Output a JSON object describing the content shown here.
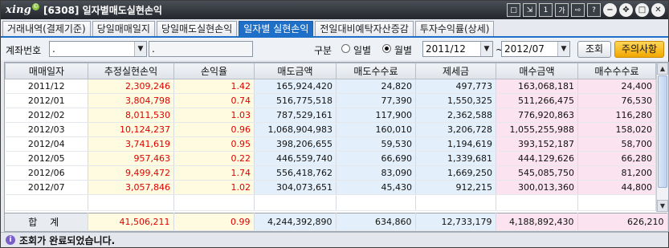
{
  "app": {
    "logo": "xing",
    "logo_badge": "©",
    "title": "[6308] 일자별매도실현손익"
  },
  "window_controls": {
    "sq1": "□",
    "sq2": "⇲",
    "sq3": "1",
    "sq4": "가",
    "sq5": "⇨",
    "sq6": "?",
    "minimize": "−",
    "move": "✥",
    "maximize": "□",
    "close": "✕"
  },
  "tabs": [
    {
      "label": "거래내역(결제기준)"
    },
    {
      "label": "당일매매일지"
    },
    {
      "label": "당일매도실현손익"
    },
    {
      "label": "일자별 실현손익"
    },
    {
      "label": "전일대비예탁자산증감"
    },
    {
      "label": "투자수익률(상세)"
    }
  ],
  "filter": {
    "account_label": "계좌번호",
    "account_value": ".",
    "account_name_value": ".",
    "period_label": "구분",
    "radio_daily": "일별",
    "radio_monthly": "월별",
    "from_value": "2011/12",
    "to_value": "2012/07",
    "tilde": "~",
    "query_button": "조회",
    "notice_button": "주의사항"
  },
  "table": {
    "columns": [
      "매매일자",
      "추정실현손익",
      "손익율",
      "매도금액",
      "매도수수료",
      "제세금",
      "매수금액",
      "매수수수료"
    ],
    "rows": [
      [
        "2011/12",
        "2,309,246",
        "1.42",
        "165,924,420",
        "24,820",
        "497,773",
        "163,068,181",
        "24,400"
      ],
      [
        "2012/01",
        "3,804,798",
        "0.74",
        "516,775,518",
        "77,390",
        "1,550,325",
        "511,266,475",
        "76,530"
      ],
      [
        "2012/02",
        "8,011,530",
        "1.03",
        "787,529,161",
        "117,900",
        "2,362,588",
        "776,920,863",
        "116,280"
      ],
      [
        "2012/03",
        "10,124,237",
        "0.96",
        "1,068,904,983",
        "160,010",
        "3,206,728",
        "1,055,255,988",
        "158,020"
      ],
      [
        "2012/04",
        "3,741,619",
        "0.95",
        "398,206,655",
        "59,530",
        "1,194,619",
        "393,152,187",
        "58,700"
      ],
      [
        "2012/05",
        "957,463",
        "0.22",
        "446,559,740",
        "66,690",
        "1,339,681",
        "444,129,626",
        "66,280"
      ],
      [
        "2012/06",
        "9,499,472",
        "1.74",
        "556,418,762",
        "83,090",
        "1,669,250",
        "545,085,750",
        "81,200"
      ],
      [
        "2012/07",
        "3,057,846",
        "1.02",
        "304,073,651",
        "45,430",
        "912,215",
        "300,013,360",
        "44,800"
      ]
    ],
    "total": [
      "합 계",
      "41,506,211",
      "0.99",
      "4,244,392,890",
      "634,860",
      "12,733,179",
      "4,188,892,430",
      "626,210"
    ]
  },
  "status": {
    "icon": "i",
    "text": "조회가 완료되었습니다."
  }
}
